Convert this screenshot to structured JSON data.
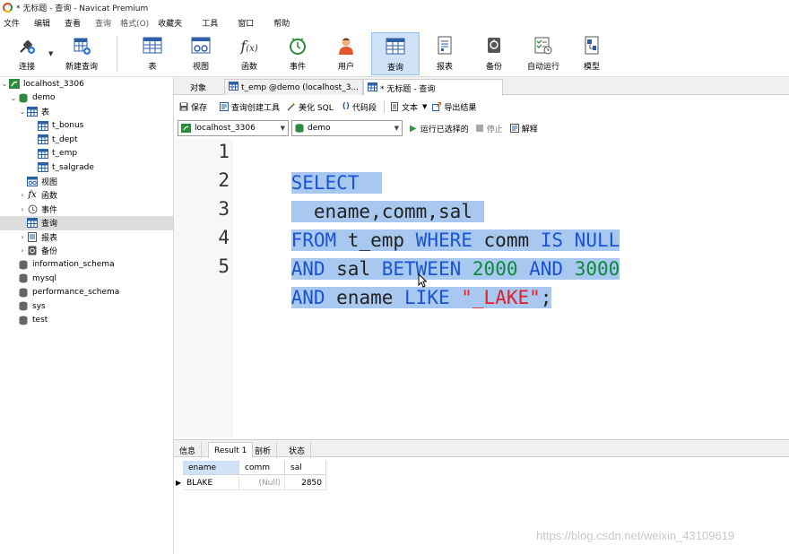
{
  "titlebar": {
    "title": "* 无标题 - 查询 - Navicat Premium"
  },
  "menu": [
    "文件",
    "编辑",
    "查看",
    "查询",
    "格式(O)",
    "收藏夹",
    "工具",
    "窗口",
    "帮助"
  ],
  "toolbar": {
    "connect": "连接",
    "new_query": "新建查询",
    "table": "表",
    "view": "视图",
    "function": "函数",
    "event": "事件",
    "user": "用户",
    "query": "查询",
    "report": "报表",
    "backup": "备份",
    "automation": "自动运行",
    "model": "模型"
  },
  "sidebar": {
    "connection": "localhost_3306",
    "database": "demo",
    "tables_label": "表",
    "tables": [
      "t_bonus",
      "t_dept",
      "t_emp",
      "t_salgrade"
    ],
    "views": "视图",
    "functions": "函数",
    "events": "事件",
    "queries": "查询",
    "reports": "报表",
    "backups": "备份",
    "other_dbs": [
      "information_schema",
      "mysql",
      "performance_schema",
      "sys",
      "test"
    ]
  },
  "tabs": {
    "objects": "对象",
    "table_tab": "t_emp @demo (localhost_3...",
    "query_tab": "* 无标题 - 查询"
  },
  "editor_toolbar": {
    "save": "保存",
    "builder": "查询创建工具",
    "beautify": "美化 SQL",
    "snippet": "代码段",
    "text": "文本",
    "export": "导出结果"
  },
  "selectors": {
    "connection": "localhost_3306",
    "database": "demo",
    "run_selected": "运行已选择的",
    "stop": "停止",
    "explain": "解释"
  },
  "code": {
    "line_numbers": [
      "1",
      "2",
      "3",
      "4",
      "5"
    ],
    "l1_kw": "SELECT",
    "l2_txt": "  ename,comm,sal",
    "l3_kw1": "FROM",
    "l3_txt1": " t_emp ",
    "l3_kw2": "WHERE",
    "l3_txt2": " comm ",
    "l3_kw3": "IS NULL",
    "l4_kw1": "AND",
    "l4_txt1": " sal ",
    "l4_kw2": "BETWEEN",
    "l4_num1": "2000",
    "l4_kw3": "AND",
    "l4_num2": "3000",
    "l5_kw1": "AND",
    "l5_txt1": " ename ",
    "l5_kw2": "LIKE",
    "l5_str": "\"_LAKE\"",
    "l5_end": ";"
  },
  "bottom_tabs": [
    "信息",
    "Result 1",
    "剖析",
    "状态"
  ],
  "result": {
    "columns": [
      "ename",
      "comm",
      "sal"
    ],
    "rows": [
      {
        "ename": "BLAKE",
        "comm": "(Null)",
        "sal": "2850"
      }
    ]
  },
  "watermark": "https://blog.csdn.net/weixin_43109619",
  "colors": {
    "keyword": "#1a53d6",
    "number": "#0e8a3a",
    "string": "#e0202a",
    "selection": "#a8c8ef"
  }
}
